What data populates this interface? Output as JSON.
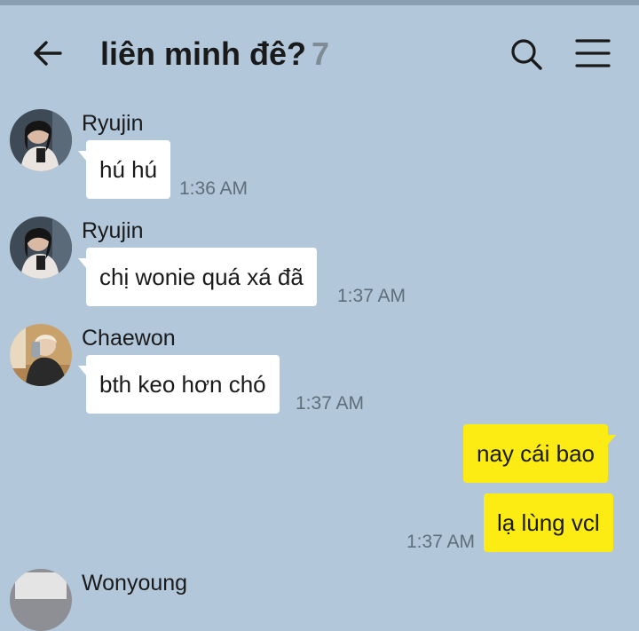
{
  "header": {
    "title": "liên minh đê?",
    "member_count": "7"
  },
  "messages": [
    {
      "sender": "Ryujin",
      "text": "hú hú",
      "time": "1:36 AM"
    },
    {
      "sender": "Ryujin",
      "text": "chị wonie quá xá đã",
      "time": "1:37 AM"
    },
    {
      "sender": "Chaewon",
      "text": "bth keo hơn chó",
      "time": "1:37 AM"
    }
  ],
  "outgoing": [
    {
      "text": "nay cái bao"
    },
    {
      "text": "lạ lùng vcl",
      "time": "1:37 AM"
    }
  ],
  "partial_sender": "Wonyoung",
  "colors": {
    "background": "#b2c7da",
    "outgoing_bubble": "#fdeb14",
    "incoming_bubble": "#ffffff",
    "member_count": "#7f8b95"
  },
  "icons": [
    "back-arrow-icon",
    "search-icon",
    "menu-icon"
  ]
}
